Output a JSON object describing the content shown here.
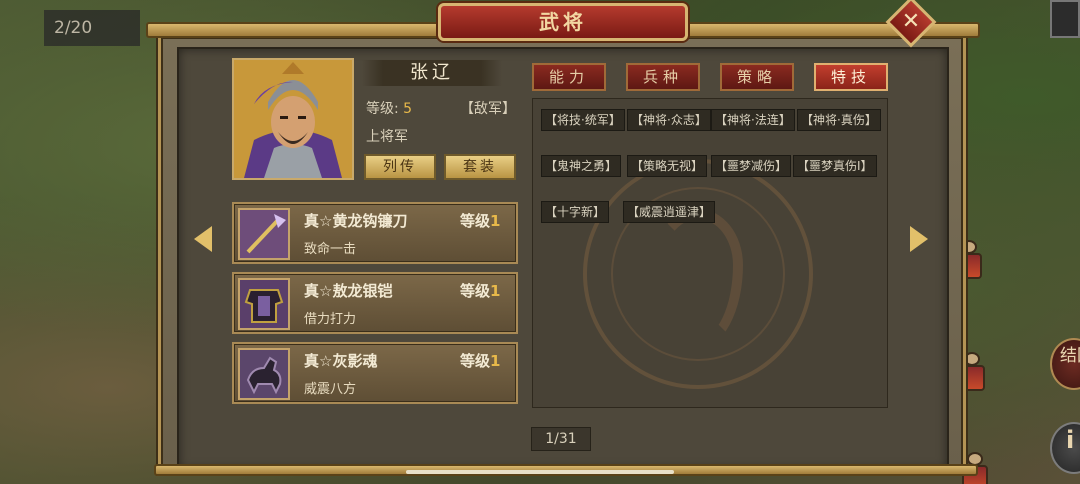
{
  "page_counter": "2/20",
  "dialog": {
    "title": "武将",
    "close_label": "✕"
  },
  "side_buttons": [
    "结回",
    "i"
  ],
  "hero": {
    "name": "张辽",
    "level_label": "等级: ",
    "level_value": "5",
    "faction": "【敌军】",
    "rank": "上将军",
    "bio_button": "列传",
    "set_button": "套装"
  },
  "equipment": [
    {
      "name": "真☆黄龙钩镰刀",
      "level_label": "等级",
      "level": "1",
      "effect": "致命一击",
      "icon": "glaive-icon",
      "color": "#6e4d7a"
    },
    {
      "name": "真☆敖龙银铠",
      "level_label": "等级",
      "level": "1",
      "effect": "借力打力",
      "icon": "armor-icon",
      "color": "#5a3f6a"
    },
    {
      "name": "真☆灰影魂",
      "level_label": "等级",
      "level": "1",
      "effect": "威震八方",
      "icon": "horse-icon",
      "color": "#5b466b"
    }
  ],
  "tabs": [
    {
      "label": "能力",
      "active": false
    },
    {
      "label": "兵种",
      "active": false
    },
    {
      "label": "策略",
      "active": false
    },
    {
      "label": "特技",
      "active": true
    }
  ],
  "skills": [
    "【将技·统军】",
    "【神将·众志】",
    "【神将·法连】",
    "【神将·真伤】",
    "【鬼神之勇】",
    "【策略无视】",
    "【噩梦减伤】",
    "【噩梦真伤Ⅰ】",
    "【十字新】",
    "【威震逍遥津】"
  ],
  "pager": "1/31",
  "colors": {
    "accent": "#b53b2e",
    "gold": "#e8b94a",
    "frame": "#b49454"
  }
}
